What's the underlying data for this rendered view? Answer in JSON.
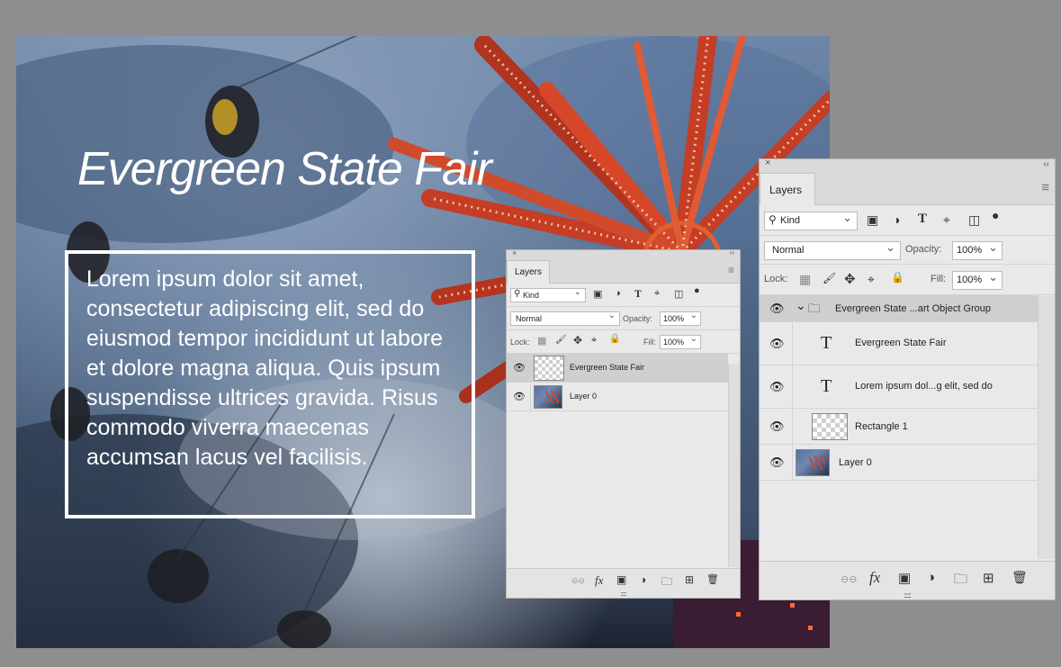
{
  "canvas": {
    "title": "Evergreen State Fair",
    "body_text": "Lorem ipsum dolor sit amet, consectetur adipiscing elit, sed do eiusmod tempor incididunt ut labore et dolore magna aliqua. Quis ipsum suspendisse ultrices gravida. Risus commodo viverra maecenas accumsan lacus vel facilisis."
  },
  "panel_small": {
    "tab_label": "Layers",
    "close_glyph": "×",
    "collapse_glyph": "‹‹",
    "menu_glyph": "≡",
    "filter": {
      "search_icon": "search-icon",
      "kind_value": "Kind"
    },
    "blend_mode": "Normal",
    "opacity_label": "Opacity:",
    "opacity_value": "100%",
    "lock_label": "Lock:",
    "fill_label": "Fill:",
    "fill_value": "100%",
    "layers": [
      {
        "name": "Evergreen State Fair",
        "selected": true,
        "thumb": "smart-object"
      },
      {
        "name": "Layer 0",
        "selected": false,
        "thumb": "photo"
      }
    ],
    "grip": "::::::"
  },
  "panel_large": {
    "tab_label": "Layers",
    "close_glyph": "×",
    "collapse_glyph": "‹‹",
    "menu_glyph": "≡",
    "filter": {
      "search_icon": "search-icon",
      "kind_value": "Kind"
    },
    "blend_mode": "Normal",
    "opacity_label": "Opacity:",
    "opacity_value": "100%",
    "lock_label": "Lock:",
    "fill_label": "Fill:",
    "fill_value": "100%",
    "layers": [
      {
        "name": "Evergreen State ...art Object Group",
        "type": "group",
        "expanded": true
      },
      {
        "name": "Evergreen State Fair",
        "type": "text"
      },
      {
        "name": "Lorem ipsum dol...g elit, sed do",
        "type": "text"
      },
      {
        "name": "Rectangle 1",
        "type": "shape"
      },
      {
        "name": "Layer 0",
        "type": "pixel"
      }
    ],
    "grip": "::::::"
  },
  "glyphs": {
    "text_layer": "T",
    "dropdown": "⌄",
    "chevron_down": "⌄",
    "filter_type_t": "T",
    "fx": "fx",
    "link": "⊖⊖",
    "new_layer": "⊞",
    "trash": "🗑",
    "lock_all": "🔒",
    "move": "✥",
    "brush": "🖌"
  }
}
